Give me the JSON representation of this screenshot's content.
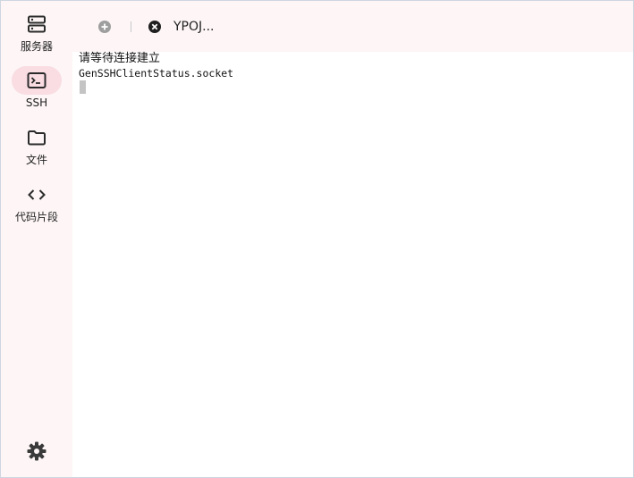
{
  "sidebar": {
    "items": [
      {
        "label": "服务器",
        "icon": "server-icon"
      },
      {
        "label": "SSH",
        "icon": "terminal-icon",
        "active": true
      },
      {
        "label": "文件",
        "icon": "folder-icon"
      },
      {
        "label": "代码片段",
        "icon": "code-icon"
      }
    ],
    "settings_icon": "gear-icon"
  },
  "tabs": {
    "add_icon": "add-circle-icon",
    "items": [
      {
        "title": "YPOJ...",
        "close_icon": "close-circle-icon"
      }
    ]
  },
  "terminal": {
    "status_text": "请等待连接建立",
    "line2": "GenSSHClientStatus.socket"
  },
  "colors": {
    "sidebar_bg": "#fdf5f6",
    "active_pill": "#f9dde3",
    "icon": "#2b2b2b"
  }
}
